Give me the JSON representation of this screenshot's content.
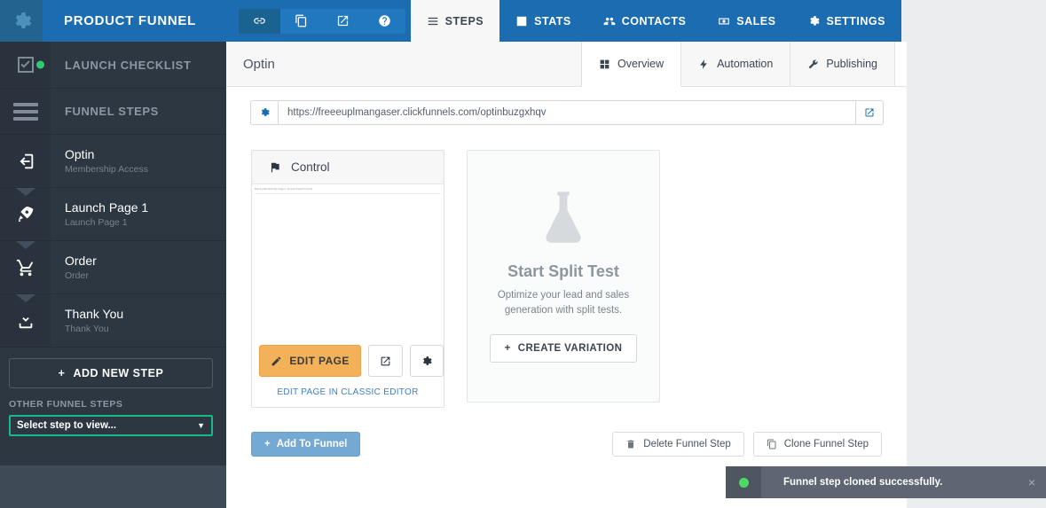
{
  "topbar": {
    "logo_icon": "gear-icon",
    "brand_title": "PRODUCT FUNNEL",
    "quick_icons": [
      {
        "name": "link-icon",
        "active": true
      },
      {
        "name": "copy-icon",
        "active": false
      },
      {
        "name": "external-link-icon",
        "active": false
      },
      {
        "name": "help-circle-icon",
        "active": false
      }
    ],
    "nav": [
      {
        "label": "STEPS",
        "icon": "hamburger-icon",
        "active": true
      },
      {
        "label": "STATS",
        "icon": "bar-chart-icon",
        "active": false
      },
      {
        "label": "CONTACTS",
        "icon": "users-icon",
        "active": false
      },
      {
        "label": "SALES",
        "icon": "money-icon",
        "active": false
      },
      {
        "label": "SETTINGS",
        "icon": "gear-icon",
        "active": false
      }
    ]
  },
  "sidebar": {
    "launch_checklist": {
      "label": "LAUNCH CHECKLIST",
      "icon": "checkbox-icon",
      "status": "complete"
    },
    "funnel_steps_header": {
      "label": "FUNNEL STEPS",
      "icon": "list-icon"
    },
    "steps": [
      {
        "name": "Optin",
        "sub": "Membership Access",
        "icon": "sign-in-icon",
        "active": true
      },
      {
        "name": "Launch Page 1",
        "sub": "Launch Page 1",
        "icon": "rocket-icon",
        "active": false
      },
      {
        "name": "Order",
        "sub": "Order",
        "icon": "shopping-cart-icon",
        "active": false
      },
      {
        "name": "Thank You",
        "sub": "Thank You",
        "icon": "download-inbox-icon",
        "active": false
      }
    ],
    "add_new_step": "ADD NEW STEP",
    "other_funnel_steps_label": "OTHER FUNNEL STEPS",
    "step_select_value": "Select step to view...",
    "select_border_color": "#19b98a"
  },
  "panel": {
    "title": "Optin",
    "subtabs": [
      {
        "label": "Overview",
        "icon": "grid-icon",
        "active": true
      },
      {
        "label": "Automation",
        "icon": "bolt-icon",
        "active": false
      },
      {
        "label": "Publishing",
        "icon": "wrench-icon",
        "active": false
      }
    ],
    "url": {
      "value": "https://freeeuplmangaser.clickfunnels.com/optinbuzgxhqv",
      "gear_icon": "gear-icon",
      "open_icon": "external-link-icon"
    }
  },
  "control_card": {
    "title": "Control",
    "flag_icon": "flag-icon",
    "thumbnail_text": "Missing Membership Page in Funnel Product Funnel",
    "edit_page_label": "EDIT PAGE",
    "edit_page_icon": "pencil-square-icon",
    "preview_icon": "external-link-icon",
    "settings_icon": "gear-icon",
    "classic_editor_link": "EDIT PAGE IN CLASSIC EDITOR",
    "accent_color": "#f3b15a"
  },
  "split_test": {
    "icon": "flask-icon",
    "title": "Start Split Test",
    "description": "Optimize your lead and sales generation with split tests.",
    "create_variation_label": "CREATE VARIATION"
  },
  "footer": {
    "add_to_funnel": "Add To Funnel",
    "delete_funnel_step": "Delete Funnel Step",
    "clone_funnel_step": "Clone Funnel Step",
    "delete_icon": "trash-icon",
    "clone_icon": "copy-icon",
    "add_color": "#74a9d4"
  },
  "toast": {
    "message": "Funnel step cloned successfully.",
    "status_color": "#4cd964",
    "close_label": "×"
  }
}
